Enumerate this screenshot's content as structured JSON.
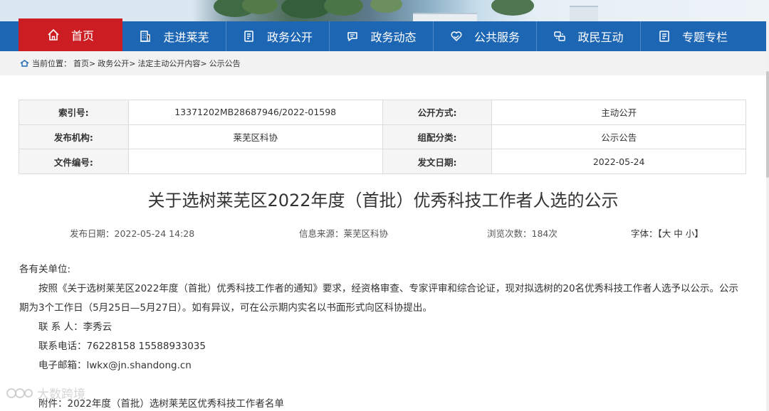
{
  "nav": {
    "items": [
      {
        "label": "首页",
        "icon": "home-icon"
      },
      {
        "label": "走进莱芜",
        "icon": "building-icon"
      },
      {
        "label": "政务公开",
        "icon": "document-icon"
      },
      {
        "label": "政务动态",
        "icon": "chat-icon"
      },
      {
        "label": "公共服务",
        "icon": "heart-hands-icon"
      },
      {
        "label": "政民互动",
        "icon": "interaction-icon"
      },
      {
        "label": "专题专栏",
        "icon": "column-icon"
      }
    ]
  },
  "breadcrumb": {
    "prefix": "当前位置：",
    "items": [
      "首页>",
      "政务公开>",
      "法定主动公开内容>",
      "公示公告"
    ]
  },
  "meta": {
    "index_label": "索引号:",
    "index_value": "13371202MB28687946/2022-01598",
    "method_label": "公开方式:",
    "method_value": "主动公开",
    "org_label": "发布机构:",
    "org_value": "莱芜区科协",
    "category_label": "组配分类:",
    "category_value": "公示公告",
    "docno_label": "文件编号:",
    "docno_value": "",
    "date_label": "发文日期:",
    "date_value": "2022-05-24"
  },
  "article": {
    "title": "关于选树莱芜区2022年度（首批）优秀科技工作者人选的公示",
    "publish_date": "发布日期：2022-05-24 14:28",
    "source": "信息来源：莱芜区科协",
    "views": "浏览次数：184次",
    "font_label": "字体：【",
    "font_large": "大",
    "font_medium": "中",
    "font_small": "小",
    "font_close": "】",
    "salutation": "各有关单位:",
    "para1_line1": "按照《关于选树莱芜区2022年度（首批）优秀科技工作者的通知》要求，经资格审查、专家评审和综合论证，现对拟选树的20名优秀科技工作者人选予以公示。公示",
    "para1_line2": "期为3个工作日（5月25日—5月27日）。如有异议，可在公示期内实名以书面形式向区科协提出。",
    "contact": "联 系 人：李秀云",
    "phone": "联系电话：76228158  15588933035",
    "email": "电子邮箱：lwkx@jn.shandong.cn",
    "attachment": "附件：2022年度（首批）选树莱芜区优秀科技工作者名单"
  },
  "watermark": "大数跨境"
}
